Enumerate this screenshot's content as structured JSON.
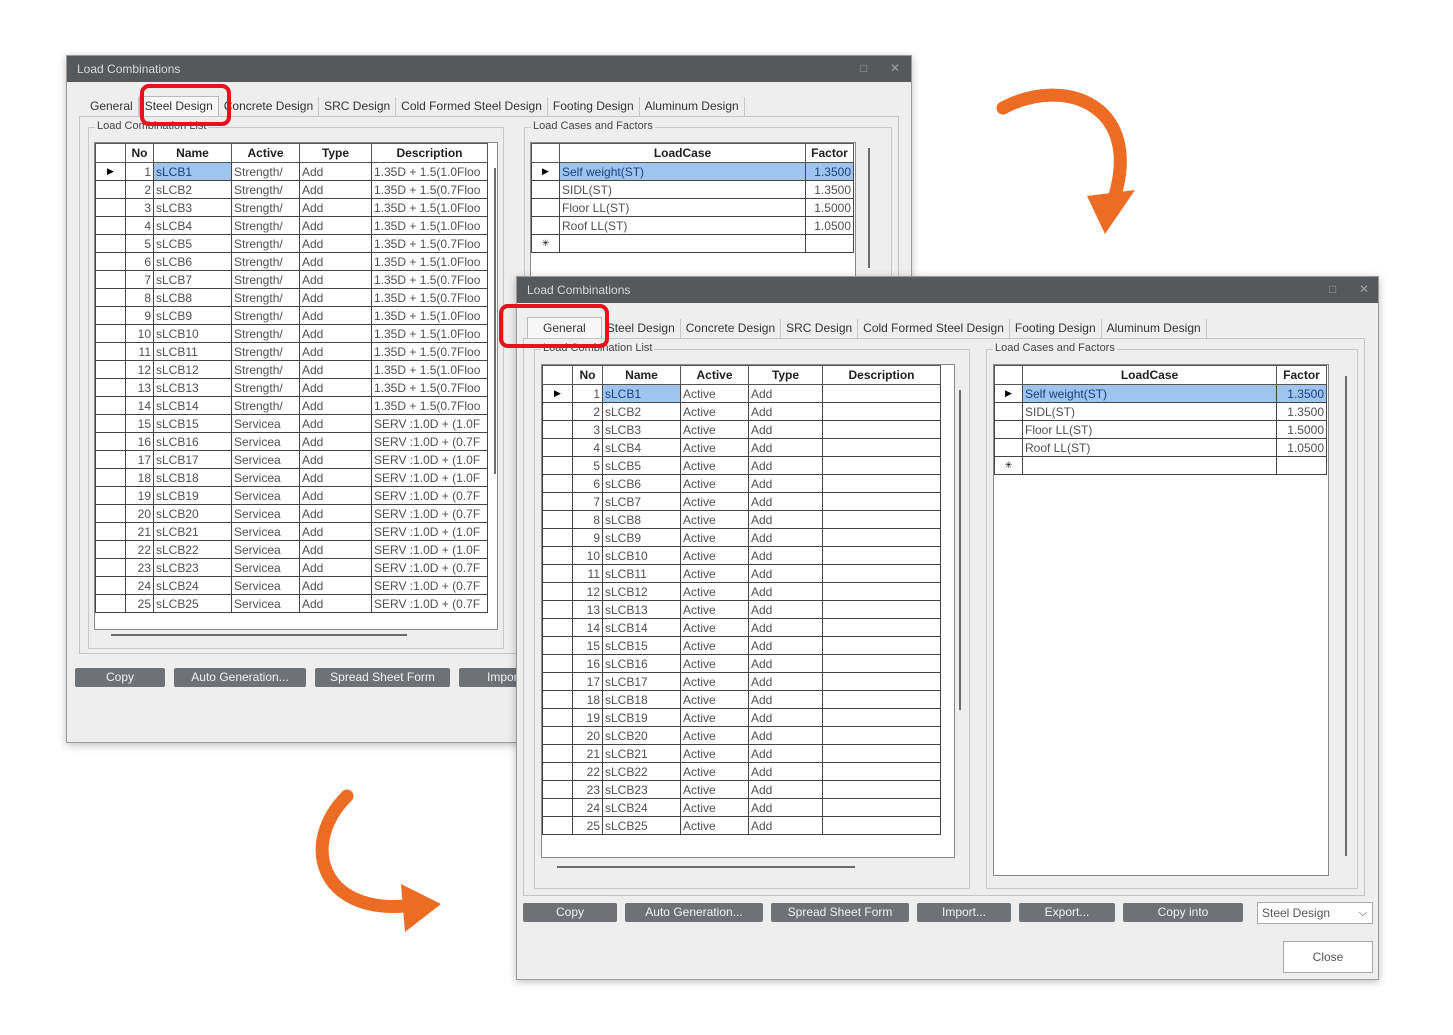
{
  "window_title": "Load Combinations",
  "window_buttons": {
    "maximize": "□",
    "close": "✕"
  },
  "tabs": [
    "General",
    "Steel Design",
    "Concrete Design",
    "SRC Design",
    "Cold Formed Steel Design",
    "Footing Design",
    "Aluminum Design"
  ],
  "back": {
    "active_tab": "Steel Design",
    "list_group_label": "Load Combination List",
    "cases_group_label": "Load Cases and Factors",
    "columns": [
      "No",
      "Name",
      "Active",
      "Type",
      "Description"
    ],
    "rows": [
      [
        "1",
        "sLCB1",
        "Strength/",
        "Add",
        "1.35D + 1.5(1.0Floo"
      ],
      [
        "2",
        "sLCB2",
        "Strength/",
        "Add",
        "1.35D + 1.5(0.7Floo"
      ],
      [
        "3",
        "sLCB3",
        "Strength/",
        "Add",
        "1.35D + 1.5(1.0Floo"
      ],
      [
        "4",
        "sLCB4",
        "Strength/",
        "Add",
        "1.35D + 1.5(1.0Floo"
      ],
      [
        "5",
        "sLCB5",
        "Strength/",
        "Add",
        "1.35D + 1.5(0.7Floo"
      ],
      [
        "6",
        "sLCB6",
        "Strength/",
        "Add",
        "1.35D + 1.5(1.0Floo"
      ],
      [
        "7",
        "sLCB7",
        "Strength/",
        "Add",
        "1.35D + 1.5(0.7Floo"
      ],
      [
        "8",
        "sLCB8",
        "Strength/",
        "Add",
        "1.35D + 1.5(0.7Floo"
      ],
      [
        "9",
        "sLCB9",
        "Strength/",
        "Add",
        "1.35D + 1.5(1.0Floo"
      ],
      [
        "10",
        "sLCB10",
        "Strength/",
        "Add",
        "1.35D + 1.5(1.0Floo"
      ],
      [
        "11",
        "sLCB11",
        "Strength/",
        "Add",
        "1.35D + 1.5(0.7Floo"
      ],
      [
        "12",
        "sLCB12",
        "Strength/",
        "Add",
        "1.35D + 1.5(1.0Floo"
      ],
      [
        "13",
        "sLCB13",
        "Strength/",
        "Add",
        "1.35D + 1.5(0.7Floo"
      ],
      [
        "14",
        "sLCB14",
        "Strength/",
        "Add",
        "1.35D + 1.5(0.7Floo"
      ],
      [
        "15",
        "sLCB15",
        "Servicea",
        "Add",
        "SERV :1.0D + (1.0F"
      ],
      [
        "16",
        "sLCB16",
        "Servicea",
        "Add",
        "SERV :1.0D + (0.7F"
      ],
      [
        "17",
        "sLCB17",
        "Servicea",
        "Add",
        "SERV :1.0D + (1.0F"
      ],
      [
        "18",
        "sLCB18",
        "Servicea",
        "Add",
        "SERV :1.0D + (1.0F"
      ],
      [
        "19",
        "sLCB19",
        "Servicea",
        "Add",
        "SERV :1.0D + (0.7F"
      ],
      [
        "20",
        "sLCB20",
        "Servicea",
        "Add",
        "SERV :1.0D + (0.7F"
      ],
      [
        "21",
        "sLCB21",
        "Servicea",
        "Add",
        "SERV :1.0D + (1.0F"
      ],
      [
        "22",
        "sLCB22",
        "Servicea",
        "Add",
        "SERV :1.0D + (1.0F"
      ],
      [
        "23",
        "sLCB23",
        "Servicea",
        "Add",
        "SERV :1.0D + (0.7F"
      ],
      [
        "24",
        "sLCB24",
        "Servicea",
        "Add",
        "SERV :1.0D + (0.7F"
      ],
      [
        "25",
        "sLCB25",
        "Servicea",
        "Add",
        "SERV :1.0D + (0.7F"
      ]
    ],
    "buttons": [
      "Copy",
      "Auto Generation...",
      "Spread Sheet Form",
      "Import"
    ]
  },
  "front": {
    "active_tab": "General",
    "list_group_label": "Load Combination List",
    "cases_group_label": "Load Cases and Factors",
    "columns": [
      "No",
      "Name",
      "Active",
      "Type",
      "Description"
    ],
    "rows": [
      [
        "1",
        "sLCB1",
        "Active",
        "Add",
        ""
      ],
      [
        "2",
        "sLCB2",
        "Active",
        "Add",
        ""
      ],
      [
        "3",
        "sLCB3",
        "Active",
        "Add",
        ""
      ],
      [
        "4",
        "sLCB4",
        "Active",
        "Add",
        ""
      ],
      [
        "5",
        "sLCB5",
        "Active",
        "Add",
        ""
      ],
      [
        "6",
        "sLCB6",
        "Active",
        "Add",
        ""
      ],
      [
        "7",
        "sLCB7",
        "Active",
        "Add",
        ""
      ],
      [
        "8",
        "sLCB8",
        "Active",
        "Add",
        ""
      ],
      [
        "9",
        "sLCB9",
        "Active",
        "Add",
        ""
      ],
      [
        "10",
        "sLCB10",
        "Active",
        "Add",
        ""
      ],
      [
        "11",
        "sLCB11",
        "Active",
        "Add",
        ""
      ],
      [
        "12",
        "sLCB12",
        "Active",
        "Add",
        ""
      ],
      [
        "13",
        "sLCB13",
        "Active",
        "Add",
        ""
      ],
      [
        "14",
        "sLCB14",
        "Active",
        "Add",
        ""
      ],
      [
        "15",
        "sLCB15",
        "Active",
        "Add",
        ""
      ],
      [
        "16",
        "sLCB16",
        "Active",
        "Add",
        ""
      ],
      [
        "17",
        "sLCB17",
        "Active",
        "Add",
        ""
      ],
      [
        "18",
        "sLCB18",
        "Active",
        "Add",
        ""
      ],
      [
        "19",
        "sLCB19",
        "Active",
        "Add",
        ""
      ],
      [
        "20",
        "sLCB20",
        "Active",
        "Add",
        ""
      ],
      [
        "21",
        "sLCB21",
        "Active",
        "Add",
        ""
      ],
      [
        "22",
        "sLCB22",
        "Active",
        "Add",
        ""
      ],
      [
        "23",
        "sLCB23",
        "Active",
        "Add",
        ""
      ],
      [
        "24",
        "sLCB24",
        "Active",
        "Add",
        ""
      ],
      [
        "25",
        "sLCB25",
        "Active",
        "Add",
        ""
      ]
    ],
    "buttons": [
      "Copy",
      "Auto Generation...",
      "Spread Sheet Form",
      "Import...",
      "Export...",
      "Copy into"
    ],
    "design_select": "Steel Design",
    "close_label": "Close"
  },
  "load_cases": {
    "columns": [
      "LoadCase",
      "Factor"
    ],
    "rows": [
      [
        "Self weight(ST)",
        "1.3500"
      ],
      [
        "SIDL(ST)",
        "1.3500"
      ],
      [
        "Floor LL(ST)",
        "1.5000"
      ],
      [
        "Roof LL(ST)",
        "1.0500"
      ]
    ]
  },
  "row_indicators": {
    "current": "▶",
    "new": "✳"
  },
  "icons": {
    "chevron": "chevron-down-icon"
  },
  "colors": {
    "highlight": "#e8111b",
    "arrow": "#ec6c23",
    "selection": "#9fc4ee",
    "button": "#6e7277",
    "titlebar": "#55595c"
  }
}
